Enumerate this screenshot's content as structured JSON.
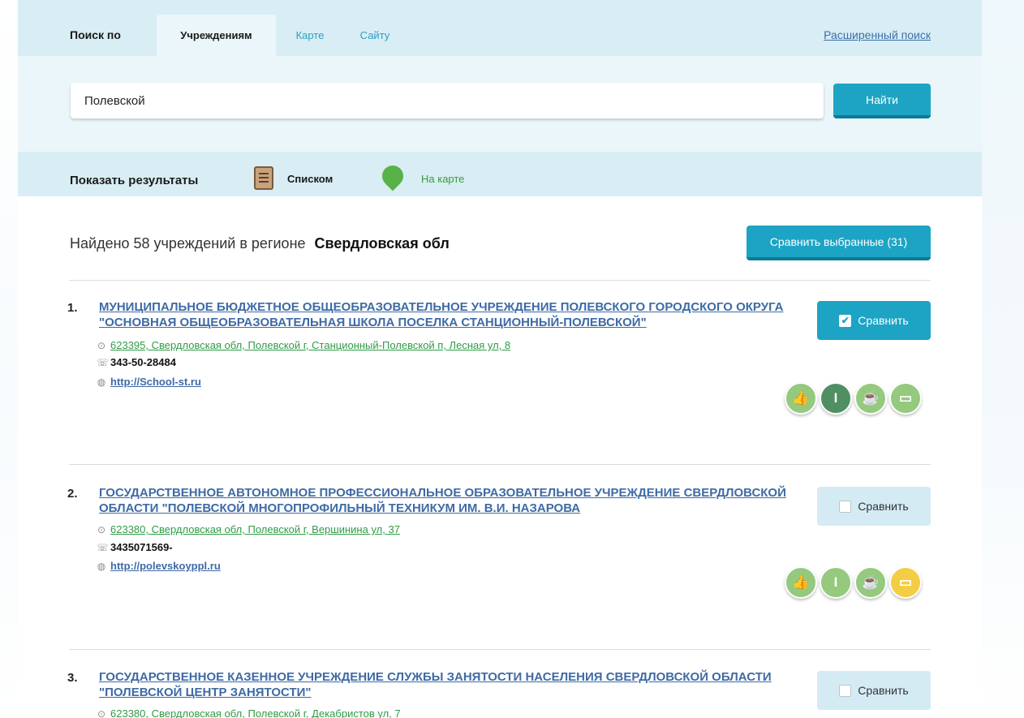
{
  "search_tabs": {
    "search_by_label": "Поиск по",
    "tabs": [
      {
        "label": "Учреждениям",
        "active": true
      },
      {
        "label": "Карте",
        "active": false
      },
      {
        "label": "Сайту",
        "active": false
      }
    ],
    "advanced_search_link": "Расширенный поиск"
  },
  "search": {
    "query": "Полевской",
    "button_label": "Найти"
  },
  "show_results": {
    "label": "Показать результаты",
    "list_label": "Списком",
    "list_icon": "document-list-icon",
    "map_label": "На карте",
    "map_icon": "map-pin-icon"
  },
  "summary": {
    "found_text": "Найдено 58 учреждений  в регионе",
    "region": "Свердловская обл",
    "compare_selected_label": "Сравнить выбранные (31)"
  },
  "results": [
    {
      "number": "1.",
      "title": "МУНИЦИПАЛЬНОЕ БЮДЖЕТНОЕ ОБЩЕОБРАЗОВАТЕЛЬНОЕ УЧРЕЖДЕНИЕ ПОЛЕВСКОГО ГОРОДСКОГО ОКРУГА \"ОСНОВНАЯ ОБЩЕОБРАЗОВАТЕЛЬНАЯ ШКОЛА ПОСЕЛКА СТАНЦИОННЫЙ-ПОЛЕВСКОЙ\"",
      "address": "623395, Свердловская обл, Полевской г, Станционный-Полевской п, Лесная ул, 8",
      "phone": "343-50-28484",
      "website": "http://School-st.ru",
      "compare_label": "Сравнить",
      "compare_checked": true,
      "rating_icons": [
        "thumbs-up-icon",
        "tie-icon",
        "cup-icon",
        "tray-icon"
      ],
      "rating_colors": [
        "#95c97e",
        "#4f8f62",
        "#95c97e",
        "#95c97e"
      ]
    },
    {
      "number": "2.",
      "title": "ГОСУДАРСТВЕННОЕ АВТОНОМНОЕ ПРОФЕССИОНАЛЬНОЕ ОБРАЗОВАТЕЛЬНОЕ УЧРЕЖДЕНИЕ СВЕРДЛОВСКОЙ ОБЛАСТИ \"ПОЛЕВСКОЙ МНОГОПРОФИЛЬНЫЙ ТЕХНИКУМ ИМ. В.И. НАЗАРОВА",
      "address": "623380, Свердловская обл, Полевской г, Вершинина ул, 37",
      "phone": "3435071569-",
      "website": "http://polevskoyppl.ru",
      "compare_label": "Сравнить",
      "compare_checked": false,
      "rating_icons": [
        "thumbs-up-icon",
        "tie-icon",
        "cup-icon",
        "tray-icon"
      ],
      "rating_colors": [
        "#95c97e",
        "#95c97e",
        "#95c97e",
        "#f3ce45"
      ]
    },
    {
      "number": "3.",
      "title": "ГОСУДАРСТВЕННОЕ КАЗЕННОЕ УЧРЕЖДЕНИЕ СЛУЖБЫ ЗАНЯТОСТИ НАСЕЛЕНИЯ СВЕРДЛОВСКОЙ ОБЛАСТИ \"ПОЛЕВСКОЙ ЦЕНТР ЗАНЯТОСТИ\"",
      "address": "623380, Свердловская обл, Полевской г, Декабристов ул, 7",
      "compare_label": "Сравнить",
      "compare_checked": false
    }
  ]
}
